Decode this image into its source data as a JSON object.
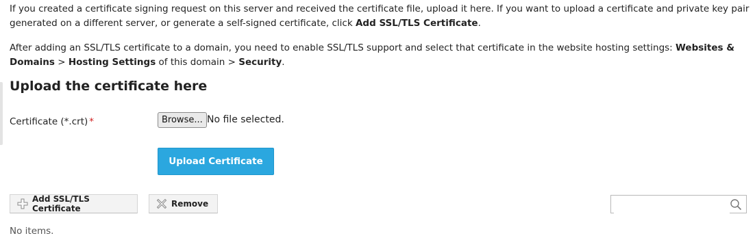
{
  "intro": {
    "text1": "If you created a certificate signing request on this server and received the certificate file, upload it here. If you want to upload a certificate and private key pair generated on a different server, or generate a self-signed certificate, click ",
    "bold1": "Add SSL/TLS Certificate",
    "end1": ".",
    "text2": "After adding an SSL/TLS certificate to a domain, you need to enable SSL/TLS support and select that certificate in the website hosting settings: ",
    "bold2a": "Websites & Domains",
    "sep": " > ",
    "bold2b": "Hosting Settings",
    "text2b": " of this domain > ",
    "bold2c": "Security",
    "end2": "."
  },
  "upload": {
    "heading": "Upload the certificate here",
    "field_label": "Certificate (*.crt)",
    "required_mark": "*",
    "browse_label": "Browse...",
    "file_status": "No file selected.",
    "submit_label": "Upload Certificate"
  },
  "toolbar": {
    "add_label": "Add SSL/TLS Certificate",
    "remove_label": "Remove",
    "search_placeholder": ""
  },
  "list": {
    "empty_text": "No items."
  }
}
